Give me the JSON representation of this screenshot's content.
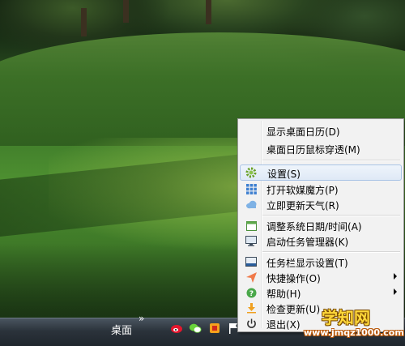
{
  "taskbar": {
    "desktop_label": "桌面",
    "overflow_chevron": "»",
    "tray_icons": [
      "weibo-icon",
      "wechat-icon",
      "app-icon",
      "flag-icon"
    ]
  },
  "menu": {
    "items": [
      {
        "label": "显示桌面日历(D)",
        "icon": null
      },
      {
        "label": "桌面日历鼠标穿透(M)",
        "icon": null
      },
      {
        "label": "设置(S)",
        "icon": "gear-icon",
        "highlighted": true
      },
      {
        "label": "打开软媒魔方(P)",
        "icon": "grid-icon"
      },
      {
        "label": "立即更新天气(R)",
        "icon": "cloud-icon"
      },
      {
        "label": "调整系统日期/时间(A)",
        "icon": "calendar-icon"
      },
      {
        "label": "启动任务管理器(K)",
        "icon": "monitor-icon"
      },
      {
        "label": "任务栏显示设置(T)",
        "icon": "taskbar-icon"
      },
      {
        "label": "快捷操作(O)",
        "icon": "send-icon",
        "submenu": true
      },
      {
        "label": "帮助(H)",
        "icon": "help-icon",
        "submenu": true
      },
      {
        "label": "检查更新(U)",
        "icon": "download-icon"
      },
      {
        "label": "退出(X)",
        "icon": "power-icon"
      }
    ]
  },
  "watermark": {
    "title": "学知网",
    "url": "www.jmqz1000.com"
  },
  "colors": {
    "menu_bg": "#f2f2f2",
    "highlight_border": "#a9c3e5",
    "watermark_yellow": "#ffd83a"
  }
}
